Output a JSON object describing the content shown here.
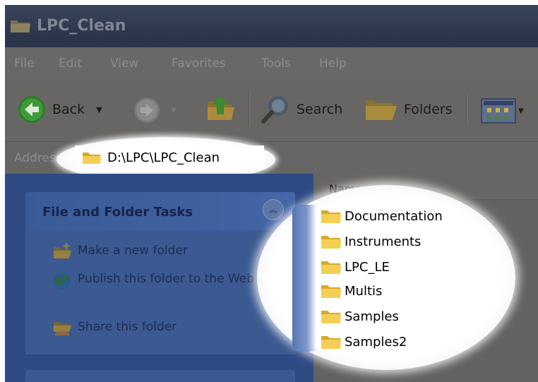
{
  "window": {
    "title": "LPC_Clean"
  },
  "menu": {
    "items": [
      "File",
      "Edit",
      "View",
      "Favorites",
      "Tools",
      "Help"
    ]
  },
  "toolbar": {
    "back_label": "Back",
    "search_label": "Search",
    "folders_label": "Folders"
  },
  "address": {
    "label": "Address",
    "path": "D:\\LPC\\LPC_Clean"
  },
  "tasks": {
    "title": "File and Folder Tasks",
    "items": [
      {
        "label": "Make a new folder",
        "icon": "new-folder-icon"
      },
      {
        "label": "Publish this folder to the Web",
        "icon": "globe-icon"
      },
      {
        "label": "Share this folder",
        "icon": "share-folder-icon"
      }
    ]
  },
  "files": {
    "column_header": "Name",
    "items": [
      "Documentation",
      "Instruments",
      "LPC_LE",
      "Multis",
      "Samples",
      "Samples2"
    ]
  },
  "colors": {
    "folder": "#f2c94c",
    "taskpane": "#2d4a83"
  }
}
